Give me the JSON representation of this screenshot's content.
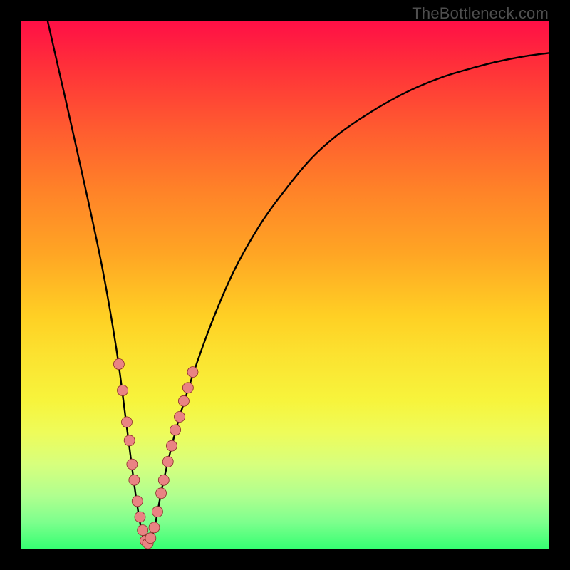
{
  "watermark": "TheBottleneck.com",
  "chart_data": {
    "type": "line",
    "title": "",
    "xlabel": "",
    "ylabel": "",
    "xlim": [
      0,
      100
    ],
    "ylim": [
      0,
      100
    ],
    "series": [
      {
        "name": "bottleneck-curve",
        "x": [
          5,
          10,
          15,
          18,
          20,
          22,
          23.5,
          25,
          27,
          30,
          35,
          40,
          45,
          50,
          55,
          60,
          65,
          70,
          75,
          80,
          85,
          90,
          95,
          100
        ],
        "y": [
          100,
          78,
          55,
          38,
          23,
          8,
          1,
          3,
          13,
          25,
          40,
          52,
          61,
          68,
          74,
          78.5,
          82,
          85,
          87.5,
          89.5,
          91,
          92.3,
          93.3,
          94
        ]
      }
    ],
    "markers": {
      "name": "highlighted-points",
      "color": "#e98383",
      "points": [
        {
          "x": 18.5,
          "y": 35
        },
        {
          "x": 19.2,
          "y": 30
        },
        {
          "x": 20.0,
          "y": 24
        },
        {
          "x": 20.5,
          "y": 20.5
        },
        {
          "x": 21.0,
          "y": 16
        },
        {
          "x": 21.4,
          "y": 13
        },
        {
          "x": 22.0,
          "y": 9
        },
        {
          "x": 22.5,
          "y": 6
        },
        {
          "x": 23.0,
          "y": 3.5
        },
        {
          "x": 23.5,
          "y": 1.5
        },
        {
          "x": 24.0,
          "y": 1
        },
        {
          "x": 24.5,
          "y": 2
        },
        {
          "x": 25.2,
          "y": 4
        },
        {
          "x": 25.8,
          "y": 7
        },
        {
          "x": 26.5,
          "y": 10.5
        },
        {
          "x": 27.0,
          "y": 13
        },
        {
          "x": 27.8,
          "y": 16.5
        },
        {
          "x": 28.5,
          "y": 19.5
        },
        {
          "x": 29.2,
          "y": 22.5
        },
        {
          "x": 30.0,
          "y": 25
        },
        {
          "x": 30.8,
          "y": 28
        },
        {
          "x": 31.6,
          "y": 30.5
        },
        {
          "x": 32.5,
          "y": 33.5
        }
      ]
    }
  },
  "colors": {
    "curve": "#000000",
    "marker_fill": "#e98383",
    "marker_stroke": "#8a2a2a",
    "frame": "#000000"
  }
}
